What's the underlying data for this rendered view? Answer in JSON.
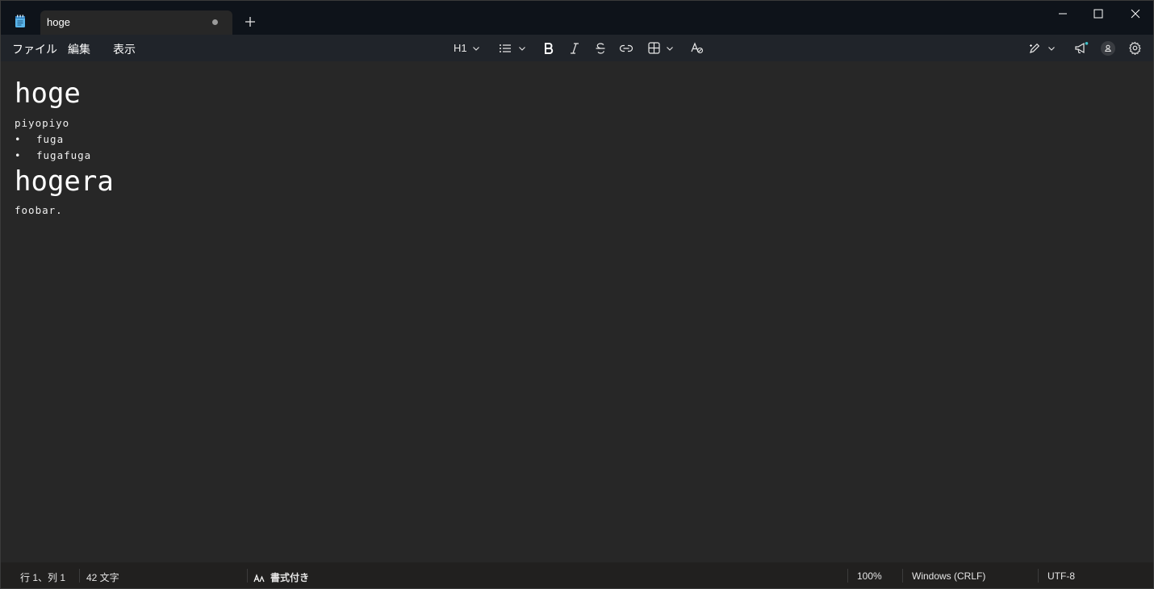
{
  "tab": {
    "title": "hoge"
  },
  "menu": {
    "file": "ファイル",
    "edit": "編集",
    "view": "表示"
  },
  "toolbar": {
    "heading_level": "H1"
  },
  "document": {
    "heading1": "hoge",
    "para1": "piyopiyo",
    "list": [
      "fuga",
      "fugafuga"
    ],
    "bullet": "•",
    "heading2": "hogera",
    "para2": "foobar."
  },
  "status": {
    "position": "行 1、列 1",
    "chars": "42 文字",
    "format": "書式付き",
    "zoom": "100%",
    "line_ending": "Windows (CRLF)",
    "encoding": "UTF-8"
  },
  "icons": {
    "app": "notepad-icon",
    "tab_modified": "unsaved-dot-icon",
    "new_tab": "plus-icon",
    "minimize": "minimize-icon",
    "maximize": "maximize-icon",
    "close": "close-icon",
    "list": "bullet-list-icon",
    "bold": "bold-icon",
    "italic": "italic-icon",
    "strike": "strikethrough-icon",
    "link": "link-icon",
    "table": "table-icon",
    "clear_format": "clear-formatting-icon",
    "copilot": "copilot-pen-icon",
    "announce": "megaphone-icon",
    "account": "account-icon",
    "settings": "gear-icon",
    "format_status": "formatting-icon"
  },
  "colors": {
    "accent_dot": "#3fc1c9",
    "background": "#272727",
    "titlebar": "#0e131a"
  }
}
